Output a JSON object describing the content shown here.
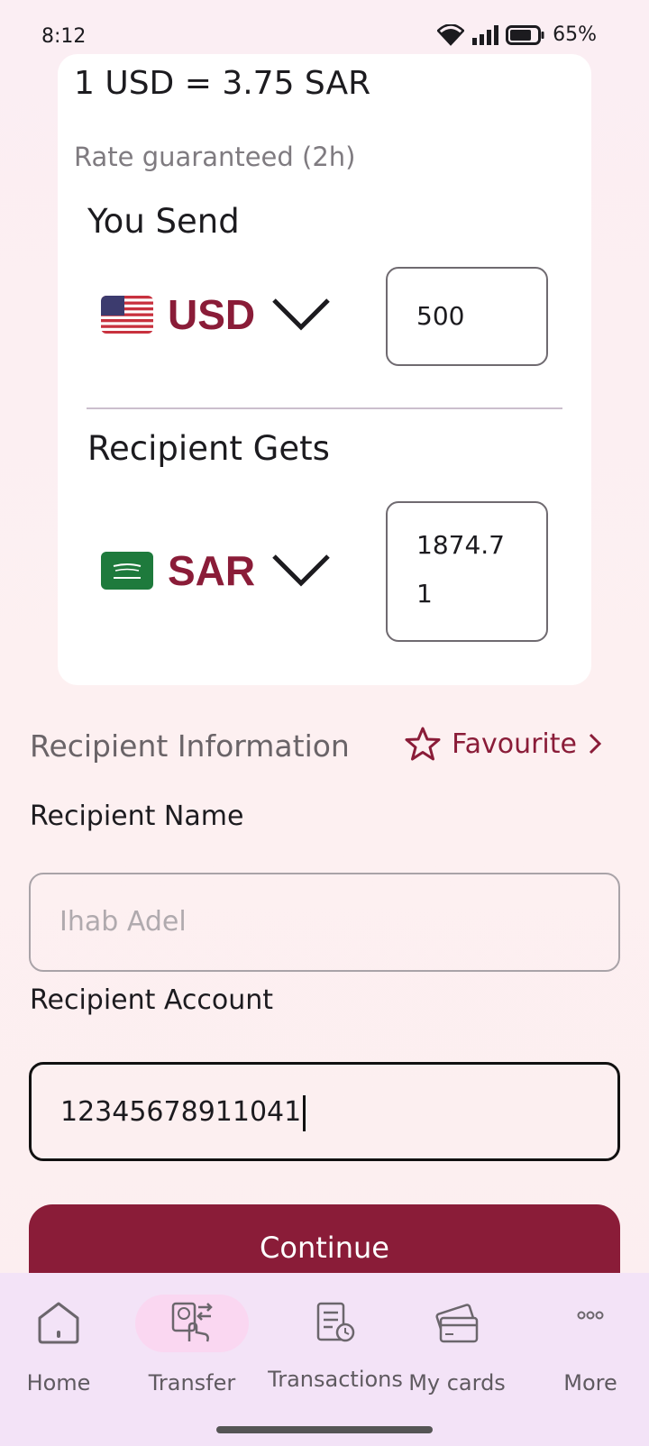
{
  "status_bar": {
    "time": "8:12",
    "battery": "65%"
  },
  "rate_card": {
    "rate": "1 USD = 3.75 SAR",
    "rate_note": "Rate guaranteed (2h)",
    "send": {
      "label": "You Send",
      "currency": "USD",
      "flag": "us-flag-icon",
      "amount": "500"
    },
    "receive": {
      "label": "Recipient Gets",
      "currency": "SAR",
      "flag": "sa-flag-icon",
      "amount_line1": "1874.7",
      "amount_line2": "1"
    }
  },
  "recipient": {
    "title": "Recipient Information",
    "favourite_label": "Favourite",
    "name_label": "Recipient Name",
    "name_placeholder": "Ihab Adel",
    "account_label": "Recipient Account",
    "account_value": "12345678911041"
  },
  "continue_label": "Continue",
  "nav": {
    "items": [
      {
        "label": "Home",
        "icon": "home-icon"
      },
      {
        "label": "Transfer",
        "icon": "transfer-icon",
        "active": true
      },
      {
        "label": "Transactions",
        "icon": "transactions-icon"
      },
      {
        "label": "My cards",
        "icon": "cards-icon"
      },
      {
        "label": "More",
        "icon": "more-icon"
      }
    ]
  },
  "colors": {
    "brand": "#8a1c38",
    "nav_bg": "#f3e3f7",
    "active_pill": "#fad7f1"
  }
}
